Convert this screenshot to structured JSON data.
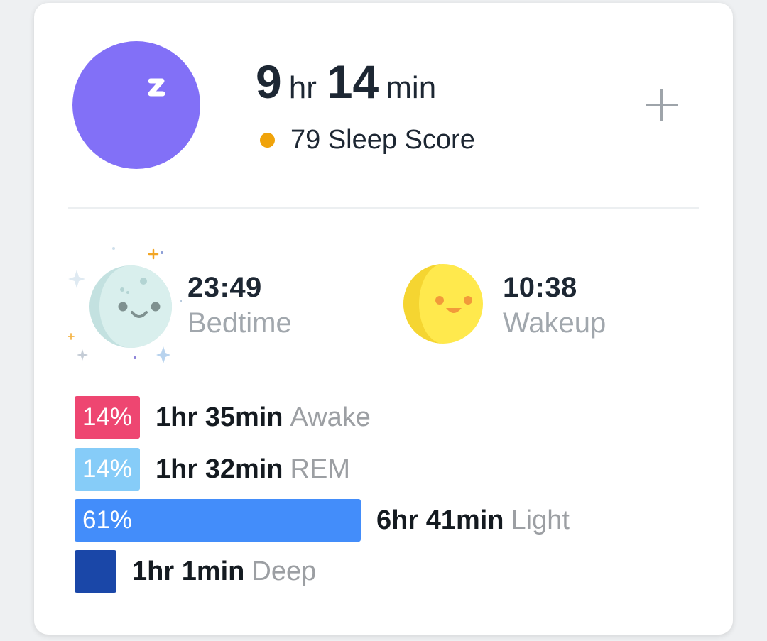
{
  "summary": {
    "hours": "9",
    "hours_unit": "hr",
    "minutes": "14",
    "minutes_unit": "min",
    "score_text": "79 Sleep Score",
    "score_dot_color": "#f0a30a",
    "icon_color": "#8270f7"
  },
  "bedtime": {
    "time": "23:49",
    "label": "Bedtime"
  },
  "wakeup": {
    "time": "10:38",
    "label": "Wakeup"
  },
  "stages": [
    {
      "percent_label": "14%",
      "percent": 14,
      "duration": "1hr 35min",
      "name": "Awake",
      "color": "#ee4671"
    },
    {
      "percent_label": "14%",
      "percent": 14,
      "duration": "1hr 32min",
      "name": "REM",
      "color": "#86ccf8"
    },
    {
      "percent_label": "61%",
      "percent": 61,
      "duration": "6hr 41min",
      "name": "Light",
      "color": "#438dfa"
    },
    {
      "percent_label": "",
      "percent": 11,
      "duration": "1hr 1min",
      "name": "Deep",
      "color": "#1a47a8"
    }
  ],
  "icons": {
    "sleep": "moon-zzz-icon",
    "add": "plus-icon",
    "bedtime": "sleepy-moon-icon",
    "wakeup": "smiling-sun-icon"
  }
}
